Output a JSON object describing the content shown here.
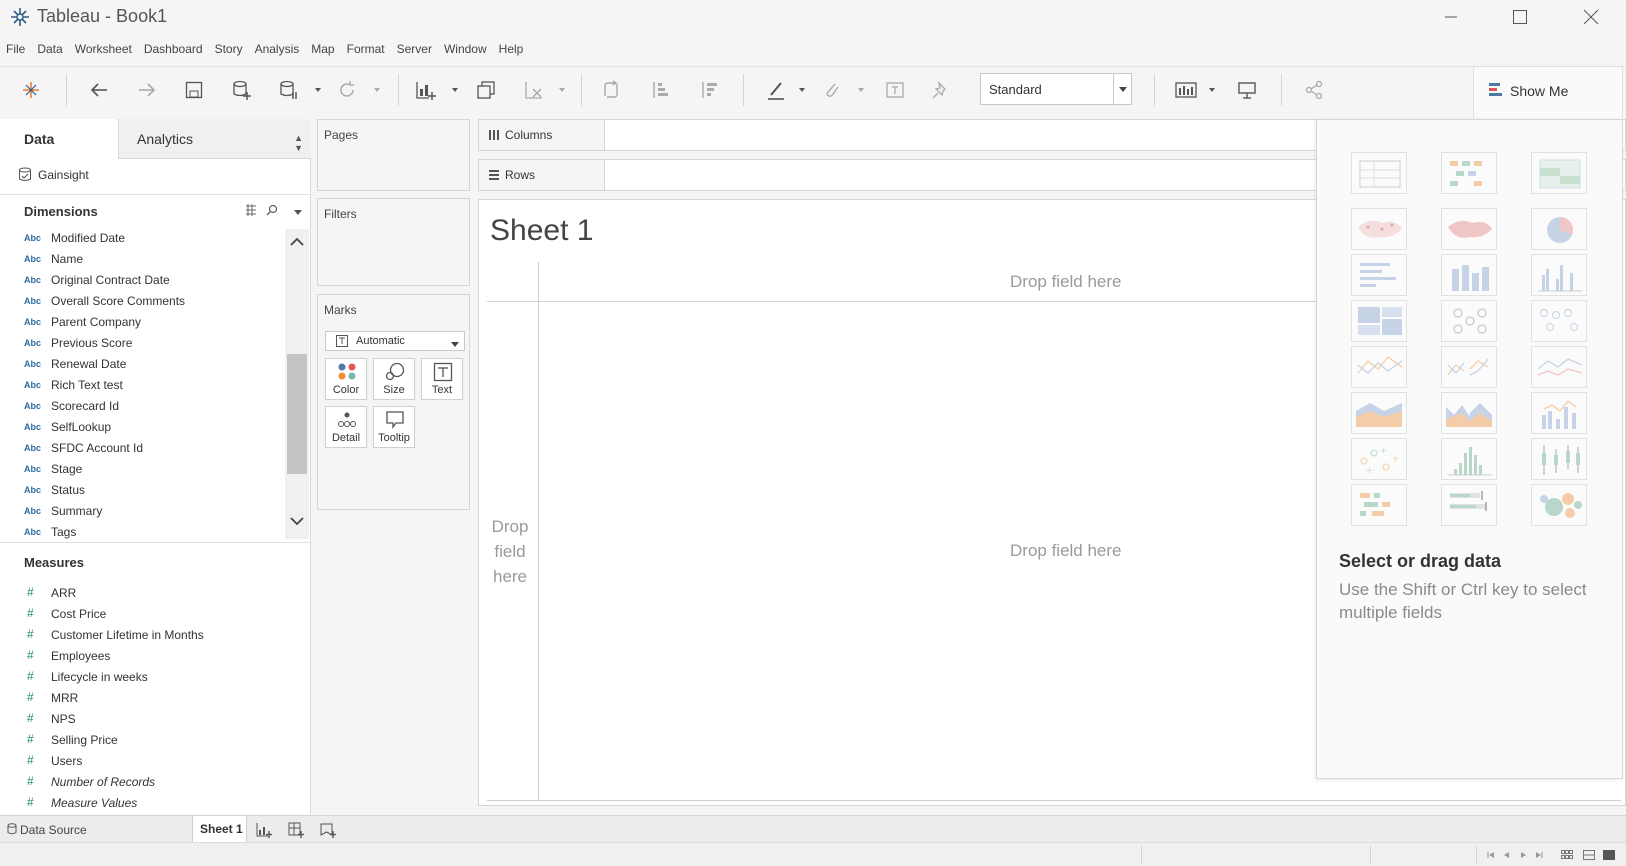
{
  "window": {
    "title": "Tableau - Book1"
  },
  "menu": [
    "File",
    "Data",
    "Worksheet",
    "Dashboard",
    "Story",
    "Analysis",
    "Map",
    "Format",
    "Server",
    "Window",
    "Help"
  ],
  "toolbar": {
    "fit_value": "Standard",
    "show_me_label": "Show Me",
    "icons": [
      "tableau-logo-icon",
      "undo-icon",
      "redo-icon",
      "save-icon",
      "new-data-source-icon",
      "pause-updates-icon",
      "refresh-icon",
      "new-worksheet-icon",
      "duplicate-sheet-icon",
      "clear-sheet-icon",
      "swap-rows-columns-icon",
      "sort-ascending-icon",
      "sort-descending-icon",
      "highlight-icon",
      "group-members-icon",
      "show-mark-labels-icon",
      "fix-axes-icon",
      "show-cards-icon",
      "presentation-mode-icon",
      "share-icon"
    ]
  },
  "data_pane": {
    "tabs": {
      "data": "Data",
      "analytics": "Analytics"
    },
    "data_source": "Gainsight",
    "dimensions_header": "Dimensions",
    "dimension_type": "Abc",
    "dimensions": [
      "Modified Date",
      "Name",
      "Original Contract Date",
      "Overall Score Comments",
      "Parent Company",
      "Previous Score",
      "Renewal Date",
      "Rich Text test",
      "Scorecard Id",
      "SelfLookup",
      "SFDC Account Id",
      "Stage",
      "Status",
      "Summary",
      "Tags"
    ],
    "measures_header": "Measures",
    "measures": [
      "ARR",
      "Cost Price",
      "Customer Lifetime in Months",
      "Employees",
      "Lifecycle in weeks",
      "MRR",
      "NPS",
      "Selling Price",
      "Users"
    ],
    "generated_measures": [
      "Number of Records",
      "Measure Values"
    ]
  },
  "shelves": {
    "pages": "Pages",
    "filters": "Filters",
    "marks": "Marks",
    "mark_type": "Automatic",
    "mark_buttons": {
      "color": "Color",
      "size": "Size",
      "text": "Text",
      "detail": "Detail",
      "tooltip": "Tooltip"
    },
    "columns": "Columns",
    "rows": "Rows"
  },
  "view": {
    "sheet_title": "Sheet 1",
    "drop_top": "Drop field here",
    "drop_center": "Drop field here",
    "drop_left": "Drop field here"
  },
  "show_me": {
    "heading": "Select or drag data",
    "subtext": "Use the Shift or Ctrl key to select multiple fields",
    "chart_types": [
      "text-table",
      "heat-map",
      "highlight-table",
      "symbol-map",
      "filled-map",
      "pie-chart",
      "horizontal-bars",
      "stacked-bars",
      "side-by-side-bars",
      "treemap",
      "circle-views",
      "side-by-side-circles",
      "continuous-lines",
      "discrete-lines",
      "dual-lines",
      "continuous-area",
      "discrete-area",
      "dual-combination",
      "scatter-plot",
      "histogram",
      "box-and-whisker",
      "gantt-chart",
      "bullet-graph",
      "packed-bubbles"
    ]
  },
  "sheet_tabs": {
    "data_source": "Data Source",
    "sheets": [
      "Sheet 1"
    ]
  },
  "colors": {
    "accent_blue": "#2d6a9e",
    "measure_green": "#1f8c73",
    "tableau_orange": "#e8762b"
  }
}
